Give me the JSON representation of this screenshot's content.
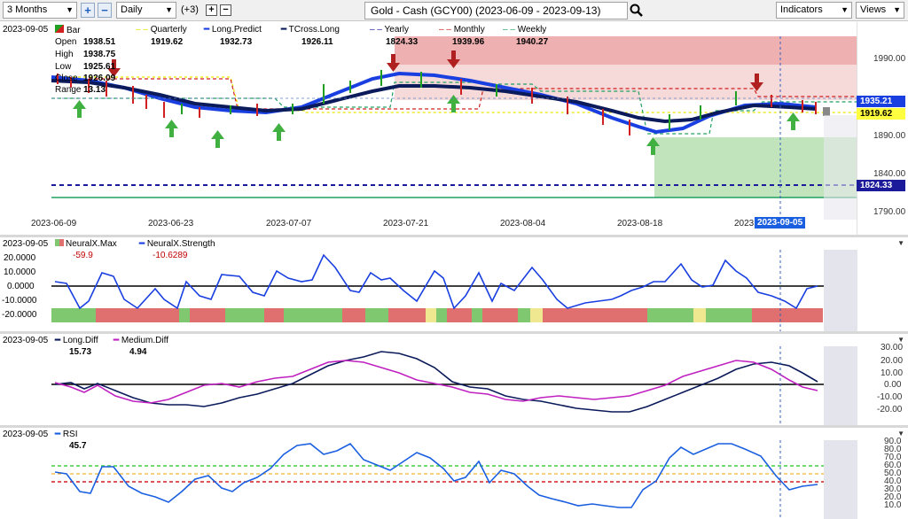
{
  "toolbar": {
    "period": "3 Months",
    "interval": "Daily",
    "plus_count": "(+3)",
    "symbol": "Gold - Cash (GCY00) (2023-06-09 - 2023-09-13)",
    "indicators_label": "Indicators",
    "views_label": "Views"
  },
  "main": {
    "date": "2023-09-05",
    "bar_label": "Bar",
    "ohlc": [
      {
        "label": "Open",
        "value": "1938.51"
      },
      {
        "label": "High",
        "value": "1938.75"
      },
      {
        "label": "Low",
        "value": "1925.61"
      },
      {
        "label": "Close",
        "value": "1926.09"
      },
      {
        "label": "Range",
        "value": "13.13"
      }
    ],
    "legend": [
      {
        "name": "Quarterly",
        "value": "1919.62",
        "color": "#e8e800"
      },
      {
        "name": "Long.Predict",
        "value": "1932.73",
        "color": "#1a3fe0"
      },
      {
        "name": "TCross.Long",
        "value": "1926.11",
        "color": "#0a1a5a"
      },
      {
        "name": "Yearly",
        "value": "1824.33",
        "color": "#1a1a9a"
      },
      {
        "name": "Monthly",
        "value": "1939.96",
        "color": "#d02020"
      },
      {
        "name": "Weekly",
        "value": "1940.27",
        "color": "#20a060"
      }
    ],
    "y_ticks": [
      "1990.00",
      "1890.00",
      "1840.00",
      "1790.00"
    ],
    "price_boxes": [
      {
        "value": "1935.21",
        "bg": "#1a3fe0",
        "fg": "#ffffff"
      },
      {
        "value": "1919.62",
        "bg": "#ffff40",
        "fg": "#000000"
      },
      {
        "value": "1824.33",
        "bg": "#1a1a9a",
        "fg": "#ffffff"
      }
    ],
    "x_labels": [
      "2023-06-09",
      "2023-06-23",
      "2023-07-07",
      "2023-07-21",
      "2023-08-04",
      "2023-08-18",
      "2023",
      "2023-09-05"
    ],
    "cursor_date": "2023-09-05"
  },
  "neural": {
    "date": "2023-09-05",
    "legend": [
      {
        "name": "NeuralX.Max",
        "value": "-59.9",
        "color": "#c00000"
      },
      {
        "name": "NeuralX.Strength",
        "value": "-10.6289",
        "color": "#c00000"
      }
    ],
    "y_ticks": [
      "20.0000",
      "10.0000",
      "0.0000",
      "-10.0000",
      "-20.0000"
    ]
  },
  "diff": {
    "date": "2023-09-05",
    "legend": [
      {
        "name": "Long.Diff",
        "value": "15.73",
        "color": "#0a1a5a"
      },
      {
        "name": "Medium.Diff",
        "value": "4.94",
        "color": "#c020c0"
      }
    ],
    "y_ticks": [
      "30.00",
      "20.00",
      "10.00",
      "0.00",
      "-10.00",
      "-20.00"
    ]
  },
  "rsi": {
    "date": "2023-09-05",
    "legend": [
      {
        "name": "RSI",
        "value": "45.7",
        "color": "#1a5fe0"
      }
    ],
    "y_ticks": [
      "90.0",
      "80.0",
      "70.0",
      "60.0",
      "50.0",
      "40.0",
      "30.0",
      "20.0",
      "10.0"
    ]
  },
  "chart_data": [
    {
      "type": "line",
      "title": "Gold - Cash (GCY00) (2023-06-09 - 2023-09-13)",
      "ylim": [
        1790,
        2000
      ],
      "y_ticks": [
        1990,
        1890,
        1840,
        1790
      ],
      "x_labels": [
        "2023-06-09",
        "2023-06-23",
        "2023-07-07",
        "2023-07-21",
        "2023-08-04",
        "2023-08-18",
        "2023-09-05"
      ],
      "series": [
        {
          "name": "Long.Predict",
          "color": "#1a3fe0",
          "values": [
            1960,
            1958,
            1950,
            1940,
            1930,
            1926,
            1925,
            1932,
            1945,
            1962,
            1962,
            1960,
            1955,
            1946,
            1935,
            1920,
            1905,
            1908,
            1918,
            1932,
            1935,
            1933
          ]
        },
        {
          "name": "TCross.Long",
          "color": "#0a1a5a",
          "values": [
            1958,
            1956,
            1950,
            1944,
            1936,
            1930,
            1927,
            1928,
            1936,
            1946,
            1950,
            1954,
            1952,
            1948,
            1940,
            1930,
            1918,
            1912,
            1915,
            1924,
            1932,
            1928
          ]
        },
        {
          "name": "Quarterly",
          "color": "#e8e800",
          "values": [
            1960,
            1960,
            1960,
            1920,
            1920,
            1920,
            1920,
            1920,
            1920,
            1920,
            1920,
            1920,
            1920,
            1920,
            1920,
            1920,
            1920,
            1920,
            1920,
            1920,
            1920,
            1920
          ]
        },
        {
          "name": "Monthly",
          "color": "#d02020",
          "values": [
            1960,
            1960,
            1960,
            1925,
            1925,
            1925,
            1925,
            1960,
            1960,
            1960,
            1920,
            1920,
            1920,
            1920,
            1955,
            1955,
            1955,
            1955,
            1940,
            1940,
            1940,
            1940
          ]
        },
        {
          "name": "Yearly",
          "color": "#1a1a9a",
          "values": [
            1824,
            1824,
            1824,
            1824,
            1824,
            1824,
            1824,
            1824,
            1824,
            1824,
            1824,
            1824,
            1824,
            1824,
            1824,
            1824,
            1824,
            1824,
            1824,
            1824,
            1824,
            1824
          ]
        }
      ]
    },
    {
      "type": "line",
      "title": "",
      "ylim": [
        -25,
        25
      ],
      "series": [
        {
          "name": "NeuralX.Strength",
          "color": "#1a3fe0",
          "values": [
            2,
            1,
            -15,
            -10,
            10,
            8,
            -10,
            -12,
            -2,
            -15,
            -8,
            2,
            -3,
            10,
            10,
            -5,
            -5,
            8,
            3,
            5,
            22,
            12,
            -3,
            -5,
            10,
            -5,
            -10,
            -2,
            8,
            3,
            10,
            -15,
            -5,
            8,
            -10,
            -18,
            -15,
            -5,
            10,
            2,
            -10,
            -15,
            -15,
            -12,
            -8,
            -2,
            -5,
            2,
            2,
            15,
            5,
            -2,
            0,
            18,
            10,
            0,
            5,
            -5,
            -8,
            -12,
            -5,
            -18,
            -2,
            -1
          ]
        }
      ]
    },
    {
      "type": "line",
      "title": "",
      "ylim": [
        -25,
        35
      ],
      "series": [
        {
          "name": "Long.Diff",
          "color": "#0a1a5a",
          "values": [
            0,
            0,
            -3,
            -1,
            -5,
            -8,
            -12,
            -14,
            -15,
            -16,
            -12,
            -8,
            -3,
            2,
            8,
            18,
            25,
            29,
            27,
            20,
            8,
            0,
            -3,
            -8,
            -12,
            -15,
            -18,
            -20,
            -21,
            -18,
            -12,
            -5,
            5,
            14,
            20,
            20,
            15,
            8,
            2
          ]
        },
        {
          "name": "Medium.Diff",
          "color": "#c020c0",
          "values": [
            2,
            -1,
            -6,
            -2,
            -8,
            -12,
            -14,
            -13,
            -8,
            -2,
            2,
            0,
            6,
            18,
            22,
            20,
            15,
            8,
            4,
            2,
            -2,
            -8,
            -12,
            -15,
            -18,
            -14,
            -12,
            -14,
            -12,
            -8,
            -2,
            8,
            15,
            20,
            19,
            10,
            0,
            -5,
            -7
          ]
        }
      ]
    },
    {
      "type": "line",
      "title": "",
      "ylim": [
        0,
        100
      ],
      "y_ticks": [
        90,
        80,
        70,
        60,
        50,
        40,
        30,
        20,
        10
      ],
      "series": [
        {
          "name": "RSI",
          "color": "#1a5fe0",
          "values": [
            55,
            55,
            32,
            30,
            60,
            60,
            40,
            28,
            25,
            20,
            33,
            48,
            52,
            38,
            30,
            40,
            50,
            60,
            75,
            85,
            86,
            75,
            80,
            85,
            70,
            55,
            48,
            35,
            55,
            60,
            35,
            55,
            45,
            30,
            20,
            15,
            12,
            10,
            8,
            30,
            60,
            70,
            62,
            75,
            85,
            85,
            80,
            65,
            48,
            32,
            35,
            38
          ]
        }
      ]
    }
  ]
}
